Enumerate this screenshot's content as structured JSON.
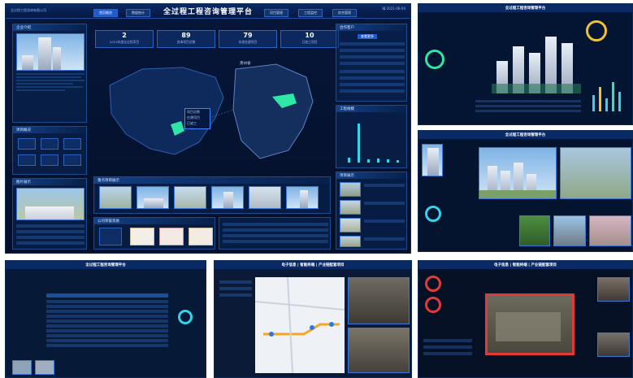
{
  "main": {
    "logo": "全过程工程咨询有限公司",
    "title": "全过程工程咨询管理平台",
    "nav_left": [
      "首页概览",
      "数据统计"
    ],
    "nav_right": [
      "项目管理",
      "工程监控",
      "综合管理"
    ],
    "datetime": "晴 2021-06-04",
    "stats": [
      {
        "value": "2",
        "label": "2021年度全过程项目"
      },
      {
        "value": "89",
        "label": "咨询项目总数"
      },
      {
        "value": "79",
        "label": "年度在建项目"
      },
      {
        "value": "10",
        "label": "已竣工项目"
      }
    ],
    "left_sections": [
      "企业介绍",
      "项目概况",
      "图片展示"
    ],
    "right_sections": [
      "合作客户",
      "工程规模",
      "项目展示"
    ],
    "mid_sections": [
      "重点项目展示",
      "公司荣誉资质"
    ],
    "province_label": "贵州省",
    "tooltip": [
      "项目总数",
      "在建项目",
      "已竣工"
    ],
    "button": "查看更多"
  },
  "tr": {
    "title": "全过程工程咨询管理平台"
  },
  "mr": {
    "title": "全过程工程咨询管理平台"
  },
  "bl": {
    "title": "全过程工程咨询管理平台"
  },
  "bm": {
    "title": "电子信息 | 智能终端 | 产业链配套项目"
  },
  "br": {
    "title": "电子信息 | 智能终端 | 产业链配套项目"
  },
  "colors": {
    "accent": "#1d5bd3",
    "cyan": "#35d3e8",
    "highlight": "#2ee6a6",
    "warning": "#e03a3a"
  }
}
